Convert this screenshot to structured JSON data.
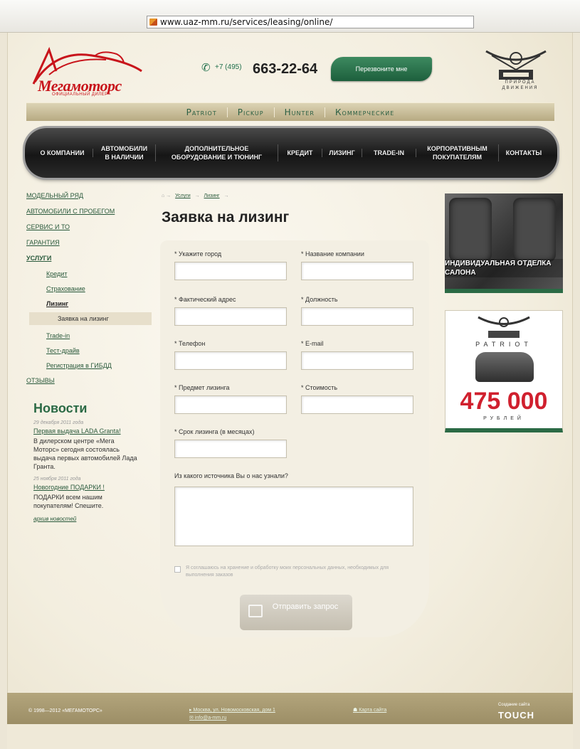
{
  "browser": {
    "url": "www.uaz-mm.ru/services/leasing/online/"
  },
  "header": {
    "logo_text": "Мегамоторс",
    "logo_sub": "ОФИЦИАЛЬНЫЙ ДИЛЕР",
    "phone_prefix": "+7 (495)",
    "phone_number": "663-22-64",
    "callback_label": "Перезвоните мне",
    "uaz_slogan": "ПРИРОДА ДВИЖЕНИЯ"
  },
  "models": [
    "Patriot",
    "Pickup",
    "Hunter",
    "Коммерческие"
  ],
  "nav": [
    "О компании",
    "Автомобили в наличии",
    "Дополнительное оборудование и тюнинг",
    "Кредит",
    "Лизинг",
    "Trade-in",
    "Корпоративным покупателям",
    "Контакты"
  ],
  "sidebar": {
    "items": [
      {
        "label": "Модельный ряд"
      },
      {
        "label": "Автомобили с пробегом"
      },
      {
        "label": "Сервис и ТО"
      },
      {
        "label": "Гарантия"
      },
      {
        "label": "Услуги"
      }
    ],
    "sub": [
      {
        "label": "Кредит"
      },
      {
        "label": "Страхование"
      },
      {
        "label": "Лизинг"
      },
      {
        "label": "Заявка на лизинг"
      },
      {
        "label": "Trade-in"
      },
      {
        "label": "Тест-драйв"
      },
      {
        "label": "Регистрация в ГИБДД"
      }
    ],
    "reviews": "Отзывы"
  },
  "news": {
    "title": "Новости",
    "items": [
      {
        "date": "29 декабря 2011 года",
        "link": "Первая выдача LADA Granta!",
        "text": "В дилерском центре «Мега Моторс» сегодня состоялась выдача первых автомобилей Лада Гранта."
      },
      {
        "date": "25 ноября 2011 года",
        "link": "Новогодние ПОДАРКИ !",
        "text": "ПОДАРКИ всем нашим покупателям! Спешите."
      }
    ],
    "archive": "архив новостей"
  },
  "breadcrumb": [
    "Услуги",
    "Лизинг"
  ],
  "page_title": "Заявка на лизинг",
  "form": {
    "city": "* Укажите город",
    "company": "* Название компании",
    "address": "* Фактический адрес",
    "position": "* Должность",
    "phone": "* Телефон",
    "email": "* E-mail",
    "subject": "* Предмет лизинга",
    "cost": "* Стоимость",
    "term": "* Срок лизинга (в месяцах)",
    "source": "Из какого источника Вы о нас узнали?",
    "consent": "Я соглашаюсь на хранение и обработку моих персональных данных, необходимых для выполнения заказов",
    "submit": "Отправить запрос"
  },
  "banners": {
    "interior_text": "ИНДИВИДУАЛЬНАЯ ОТДЕЛКА САЛОНА",
    "patriot": "PATRIOT",
    "price": "475 000",
    "currency": "РУБЛЕЙ"
  },
  "footer": {
    "copyright": "© 1998—2012 «МЕГАМОТОРС»",
    "address": "Москва, ул. Новомосковская, дом 1",
    "email": "info@a-mm.ru",
    "sitemap": "Карта сайта",
    "made_by": "Создание сайта",
    "studio": "TOUCH"
  },
  "colors": {
    "accent_green": "#2b6a45",
    "logo_red": "#c8141b",
    "price_red": "#d0202e"
  }
}
